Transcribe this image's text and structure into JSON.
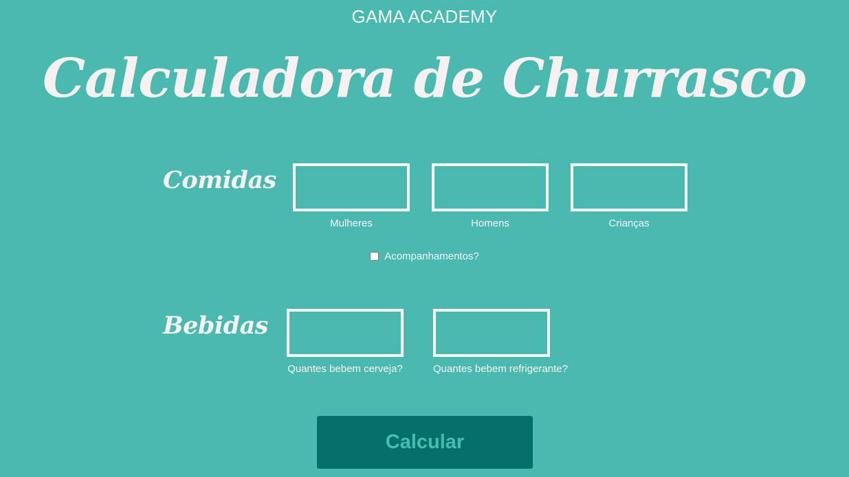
{
  "header": {
    "brand": "GAMA ACADEMY",
    "title": "Calculadora de Churrasco"
  },
  "comidas": {
    "label": "Comidas",
    "fields": [
      {
        "caption": "Mulheres",
        "value": ""
      },
      {
        "caption": "Homens",
        "value": ""
      },
      {
        "caption": "Crianças",
        "value": ""
      }
    ],
    "acompanhamentos": {
      "label": "Acompanhamentos?",
      "checked": false
    }
  },
  "bebidas": {
    "label": "Bebidas",
    "fields": [
      {
        "caption": "Quantes bebem cerveja?",
        "value": ""
      },
      {
        "caption": "Quantes bebem refrigerante?",
        "value": ""
      }
    ]
  },
  "actions": {
    "calcular_label": "Calcular"
  },
  "colors": {
    "background": "#4ab9b0",
    "button": "#05706a",
    "button_text": "#47bdb2",
    "text": "#f7f1f1"
  }
}
